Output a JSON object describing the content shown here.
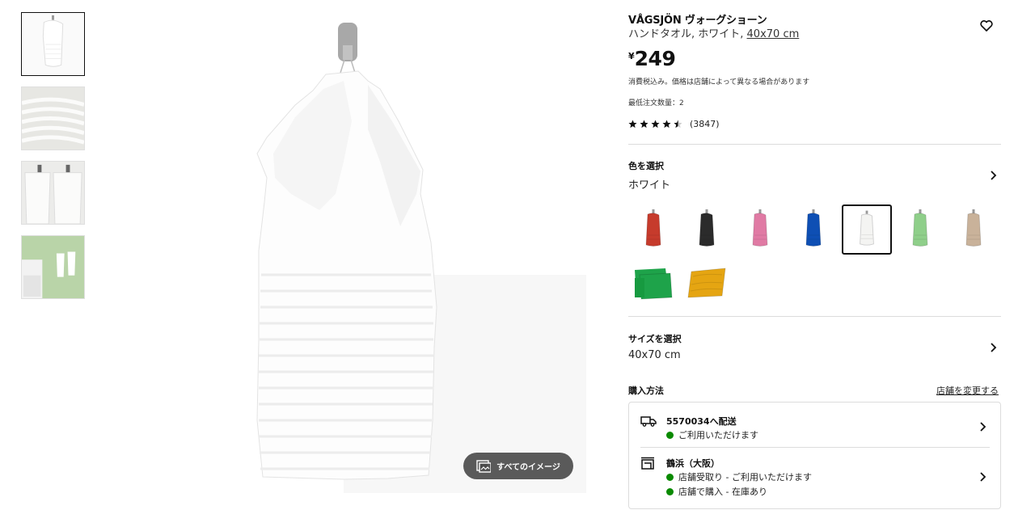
{
  "product": {
    "name": "VÅGSJÖN ヴォーグショーン",
    "description": "ハンドタオル, ホワイト, ",
    "size_link": "40x70 cm",
    "currency": "¥",
    "price": "249",
    "tax_note": "消費税込み。価格は店舗によって異なる場合があります",
    "min_order": "最低注文数量：2",
    "rating": 4.5,
    "review_count": "(3847)"
  },
  "gallery": {
    "all_images_label": "すべてのイメージ",
    "thumbnails": [
      "white-towel-hanging",
      "towel-texture-closeup",
      "towels-on-hooks",
      "bathroom-scene"
    ]
  },
  "color": {
    "label": "色を選択",
    "value": "ホワイト",
    "swatches": [
      {
        "name": "red",
        "color": "#c63b2c"
      },
      {
        "name": "black",
        "color": "#2b2b2b"
      },
      {
        "name": "pink",
        "color": "#e07aa4"
      },
      {
        "name": "blue",
        "color": "#0e4fb4"
      },
      {
        "name": "white",
        "color": "#f4f4f2",
        "selected": true
      },
      {
        "name": "light-green",
        "color": "#8fcf8a"
      },
      {
        "name": "beige",
        "color": "#c9b29a"
      },
      {
        "name": "green",
        "color": "#1ea34a"
      },
      {
        "name": "yellow",
        "color": "#e5a512"
      }
    ]
  },
  "size": {
    "label": "サイズを選択",
    "value": "40x70 cm"
  },
  "purchase": {
    "label": "購入方法",
    "change_store": "店舗を変更する",
    "delivery": {
      "title": "5570034へ配送",
      "status": "ご利用いただけます"
    },
    "store": {
      "title": "鶴浜（大阪）",
      "pickup": "店舗受取り - ご利用いただけます",
      "instore": "店舗で購入 - 在庫あり"
    },
    "status_color": "#0a8a00"
  }
}
